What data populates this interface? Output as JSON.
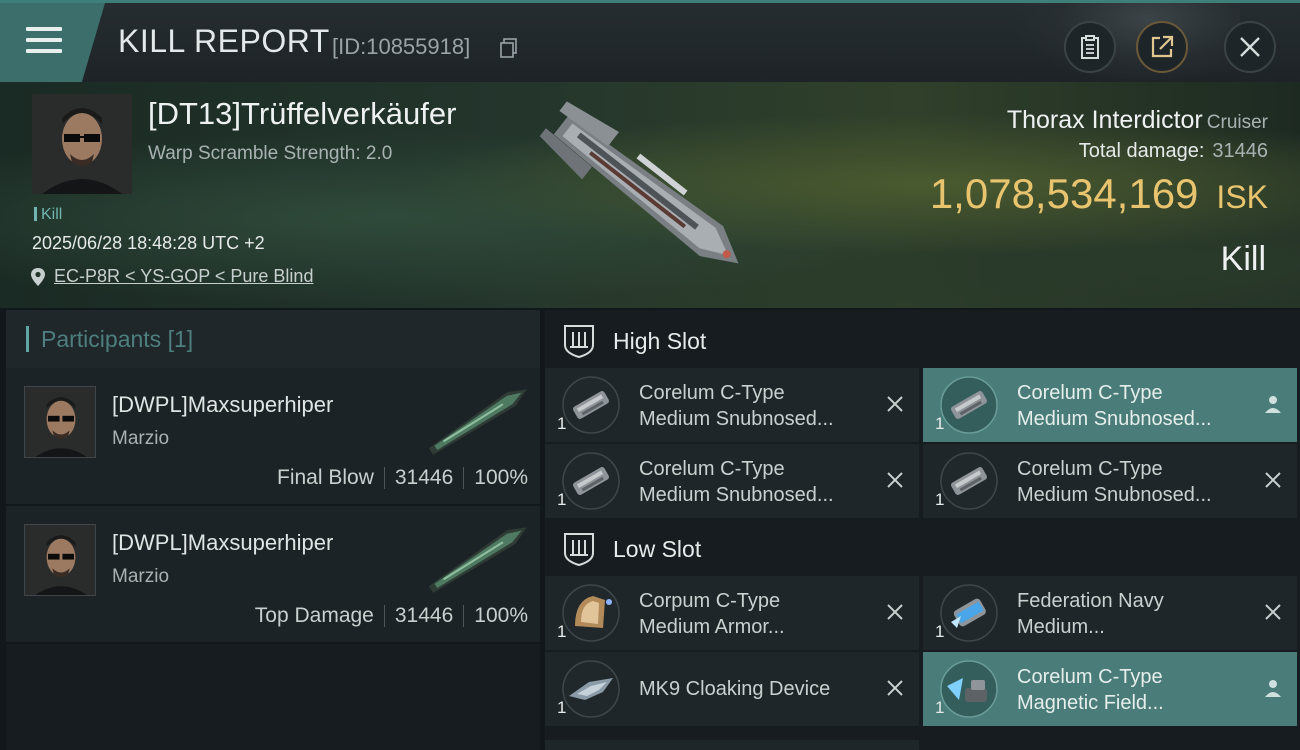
{
  "header": {
    "title": "KILL REPORT",
    "report_id": "[ID:10855918]"
  },
  "victim": {
    "name": "[DT13]Trüffelverkäufer",
    "warp_scramble": "Warp Scramble Strength: 2.0",
    "kill_tag": "Kill",
    "datetime": "2025/06/28 18:48:28 UTC +2",
    "location": "EC-P8R < YS-GOP < Pure Blind",
    "ship_name": "Thorax Interdictor",
    "ship_class": "Cruiser",
    "total_damage_label": "Total damage:",
    "total_damage": "31446",
    "isk_value": "1,078,534,169",
    "isk_unit": "ISK",
    "result": "Kill"
  },
  "participants": {
    "label": "Participants",
    "count": "[1]",
    "rows": [
      {
        "name": "[DWPL]Maxsuperhiper",
        "ship": "Marzio",
        "role": "Final Blow",
        "damage": "31446",
        "percent": "100%"
      },
      {
        "name": "[DWPL]Maxsuperhiper",
        "ship": "Marzio",
        "role": "Top Damage",
        "damage": "31446",
        "percent": "100%"
      }
    ]
  },
  "fitting": {
    "high_slot_label": "High Slot",
    "low_slot_label": "Low Slot",
    "high": [
      {
        "line1": "Corelum C-Type",
        "line2": "Medium Snubnosed...",
        "qty": "1",
        "status": "destroyed"
      },
      {
        "line1": "Corelum C-Type",
        "line2": "Medium Snubnosed...",
        "qty": "1",
        "status": "dropped"
      },
      {
        "line1": "Corelum C-Type",
        "line2": "Medium Snubnosed...",
        "qty": "1",
        "status": "destroyed"
      },
      {
        "line1": "Corelum C-Type",
        "line2": "Medium Snubnosed...",
        "qty": "1",
        "status": "destroyed"
      }
    ],
    "low": [
      {
        "line1": "Corpum C-Type",
        "line2": "Medium Armor...",
        "qty": "1",
        "status": "destroyed"
      },
      {
        "line1": "Federation Navy",
        "line2": "Medium...",
        "qty": "1",
        "status": "destroyed"
      },
      {
        "line1": "MK9 Cloaking Device",
        "line2": "",
        "qty": "1",
        "status": "destroyed"
      },
      {
        "line1": "Corelum C-Type",
        "line2": "Magnetic Field...",
        "qty": "1",
        "status": "dropped"
      }
    ]
  },
  "colors": {
    "accent": "#4a7c79",
    "isk": "#e9c46f",
    "panel": "#1e2629"
  }
}
